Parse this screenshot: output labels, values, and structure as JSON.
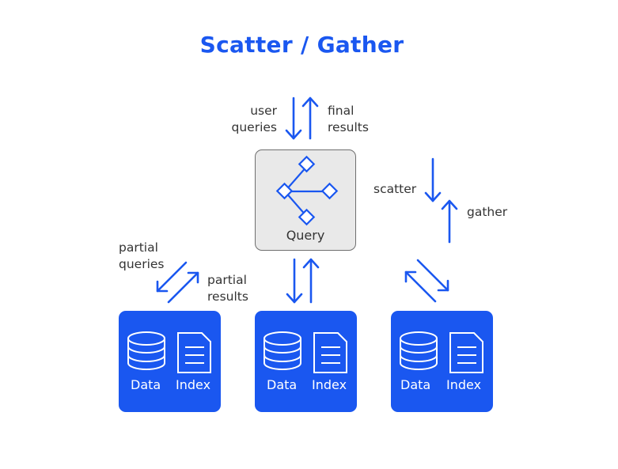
{
  "title": "Scatter / Gather",
  "colors": {
    "accent": "#1a57f0",
    "query_box_bg": "#e9e9e9",
    "text": "#333333"
  },
  "labels": {
    "user_queries": [
      "user",
      "queries"
    ],
    "final_results": [
      "final",
      "results"
    ],
    "scatter": "scatter",
    "gather": "gather",
    "partial_queries": [
      "partial",
      "queries"
    ],
    "partial_results": [
      "partial",
      "results"
    ]
  },
  "query_node": {
    "label": "Query",
    "icon": "tree-network-icon"
  },
  "data_nodes": [
    {
      "data_label": "Data",
      "index_label": "Index"
    },
    {
      "data_label": "Data",
      "index_label": "Index"
    },
    {
      "data_label": "Data",
      "index_label": "Index"
    }
  ]
}
